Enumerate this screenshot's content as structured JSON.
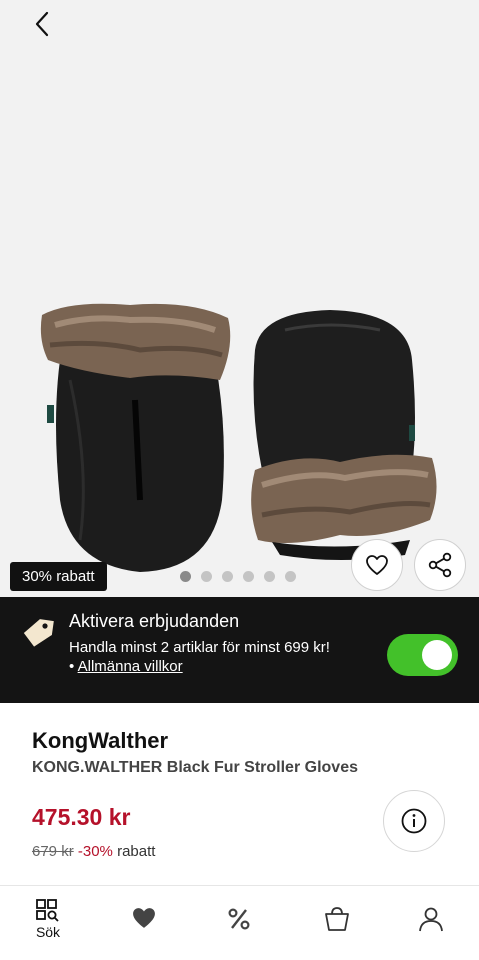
{
  "hero": {
    "discount_badge": "30% rabatt",
    "carousel": {
      "total": 6,
      "active": 0
    }
  },
  "offer": {
    "title": "Aktivera erbjudanden",
    "description": "Handla minst 2 artiklar för minst 699 kr!",
    "terms_bullet": "•",
    "terms_link": "Allmänna villkor",
    "toggle_on": true
  },
  "product": {
    "brand": "KongWalther",
    "name": "KONG.WALTHER Black Fur Stroller Gloves",
    "price": "475.30 kr",
    "old_price": "679 kr",
    "percent_off": "-30%",
    "rabatt": "rabatt"
  },
  "nav": {
    "search_label": "Sök"
  },
  "colors": {
    "sale_red": "#b5112a",
    "toggle_green": "#43c12a",
    "banner_bg": "#141414"
  },
  "icons": [
    "chevron-left-icon",
    "heart-icon",
    "share-icon",
    "price-tag-icon",
    "info-icon",
    "search-grid-icon",
    "heart-filled-icon",
    "percent-icon",
    "shopping-bag-icon",
    "user-icon"
  ]
}
